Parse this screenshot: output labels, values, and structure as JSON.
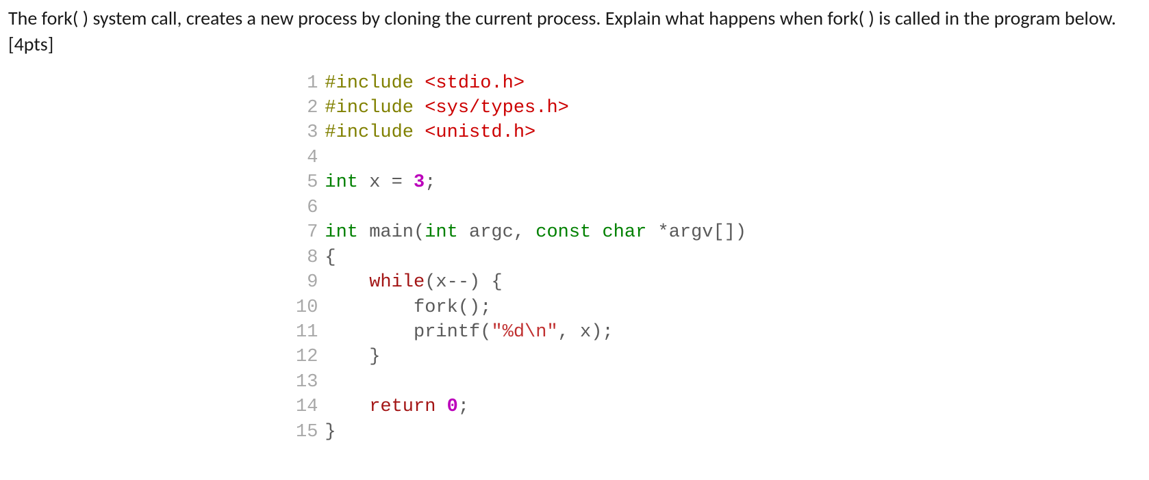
{
  "question": {
    "text": "The fork( ) system call, creates a new process by cloning the current process. Explain what happens when fork( ) is called in the program below. [4pts]"
  },
  "code": {
    "lines": [
      {
        "n": "1",
        "tokens": [
          {
            "t": "#include ",
            "c": "preproc"
          },
          {
            "t": "<stdio.h>",
            "c": "header-str"
          }
        ]
      },
      {
        "n": "2",
        "tokens": [
          {
            "t": "#include ",
            "c": "preproc"
          },
          {
            "t": "<sys/types.h>",
            "c": "header-str"
          }
        ]
      },
      {
        "n": "3",
        "tokens": [
          {
            "t": "#include ",
            "c": "preproc"
          },
          {
            "t": "<unistd.h>",
            "c": "header-str"
          }
        ]
      },
      {
        "n": "4",
        "tokens": []
      },
      {
        "n": "5",
        "tokens": [
          {
            "t": "int",
            "c": "keyword-type"
          },
          {
            "t": " x ",
            "c": "ident"
          },
          {
            "t": "=",
            "c": "op"
          },
          {
            "t": " ",
            "c": "ident"
          },
          {
            "t": "3",
            "c": "number-lit"
          },
          {
            "t": ";",
            "c": "semi"
          }
        ]
      },
      {
        "n": "6",
        "tokens": []
      },
      {
        "n": "7",
        "tokens": [
          {
            "t": "int",
            "c": "keyword-type"
          },
          {
            "t": " ",
            "c": "ident"
          },
          {
            "t": "main",
            "c": "func-name"
          },
          {
            "t": "(",
            "c": "paren"
          },
          {
            "t": "int",
            "c": "keyword-type"
          },
          {
            "t": " argc",
            "c": "ident"
          },
          {
            "t": ",",
            "c": "comma"
          },
          {
            "t": " ",
            "c": "ident"
          },
          {
            "t": "const",
            "c": "keyword-type"
          },
          {
            "t": " ",
            "c": "ident"
          },
          {
            "t": "char",
            "c": "keyword-type"
          },
          {
            "t": " ",
            "c": "ident"
          },
          {
            "t": "*",
            "c": "star"
          },
          {
            "t": "argv",
            "c": "ident"
          },
          {
            "t": "[",
            "c": "paren"
          },
          {
            "t": "]",
            "c": "paren"
          },
          {
            "t": ")",
            "c": "paren"
          }
        ]
      },
      {
        "n": "8",
        "tokens": [
          {
            "t": "{",
            "c": "brace"
          }
        ]
      },
      {
        "n": "9",
        "tokens": [
          {
            "t": "    ",
            "c": "ident"
          },
          {
            "t": "while",
            "c": "keyword-ctrl"
          },
          {
            "t": "(",
            "c": "paren"
          },
          {
            "t": "x",
            "c": "ident"
          },
          {
            "t": "--",
            "c": "op"
          },
          {
            "t": ")",
            "c": "paren"
          },
          {
            "t": " ",
            "c": "ident"
          },
          {
            "t": "{",
            "c": "brace"
          }
        ]
      },
      {
        "n": "10",
        "tokens": [
          {
            "t": "        ",
            "c": "ident"
          },
          {
            "t": "fork",
            "c": "func-name"
          },
          {
            "t": "(",
            "c": "paren"
          },
          {
            "t": ")",
            "c": "paren"
          },
          {
            "t": ";",
            "c": "semi"
          }
        ]
      },
      {
        "n": "11",
        "tokens": [
          {
            "t": "        ",
            "c": "ident"
          },
          {
            "t": "printf",
            "c": "func-name"
          },
          {
            "t": "(",
            "c": "paren"
          },
          {
            "t": "\"%d",
            "c": "string"
          },
          {
            "t": "\\n",
            "c": "escape"
          },
          {
            "t": "\"",
            "c": "string"
          },
          {
            "t": ",",
            "c": "comma"
          },
          {
            "t": " x",
            "c": "ident"
          },
          {
            "t": ")",
            "c": "paren"
          },
          {
            "t": ";",
            "c": "semi"
          }
        ]
      },
      {
        "n": "12",
        "tokens": [
          {
            "t": "    ",
            "c": "ident"
          },
          {
            "t": "}",
            "c": "brace"
          }
        ]
      },
      {
        "n": "13",
        "tokens": []
      },
      {
        "n": "14",
        "tokens": [
          {
            "t": "    ",
            "c": "ident"
          },
          {
            "t": "return",
            "c": "keyword-ctrl"
          },
          {
            "t": " ",
            "c": "ident"
          },
          {
            "t": "0",
            "c": "number-lit"
          },
          {
            "t": ";",
            "c": "semi"
          }
        ]
      },
      {
        "n": "15",
        "tokens": [
          {
            "t": "}",
            "c": "brace"
          }
        ]
      }
    ]
  }
}
